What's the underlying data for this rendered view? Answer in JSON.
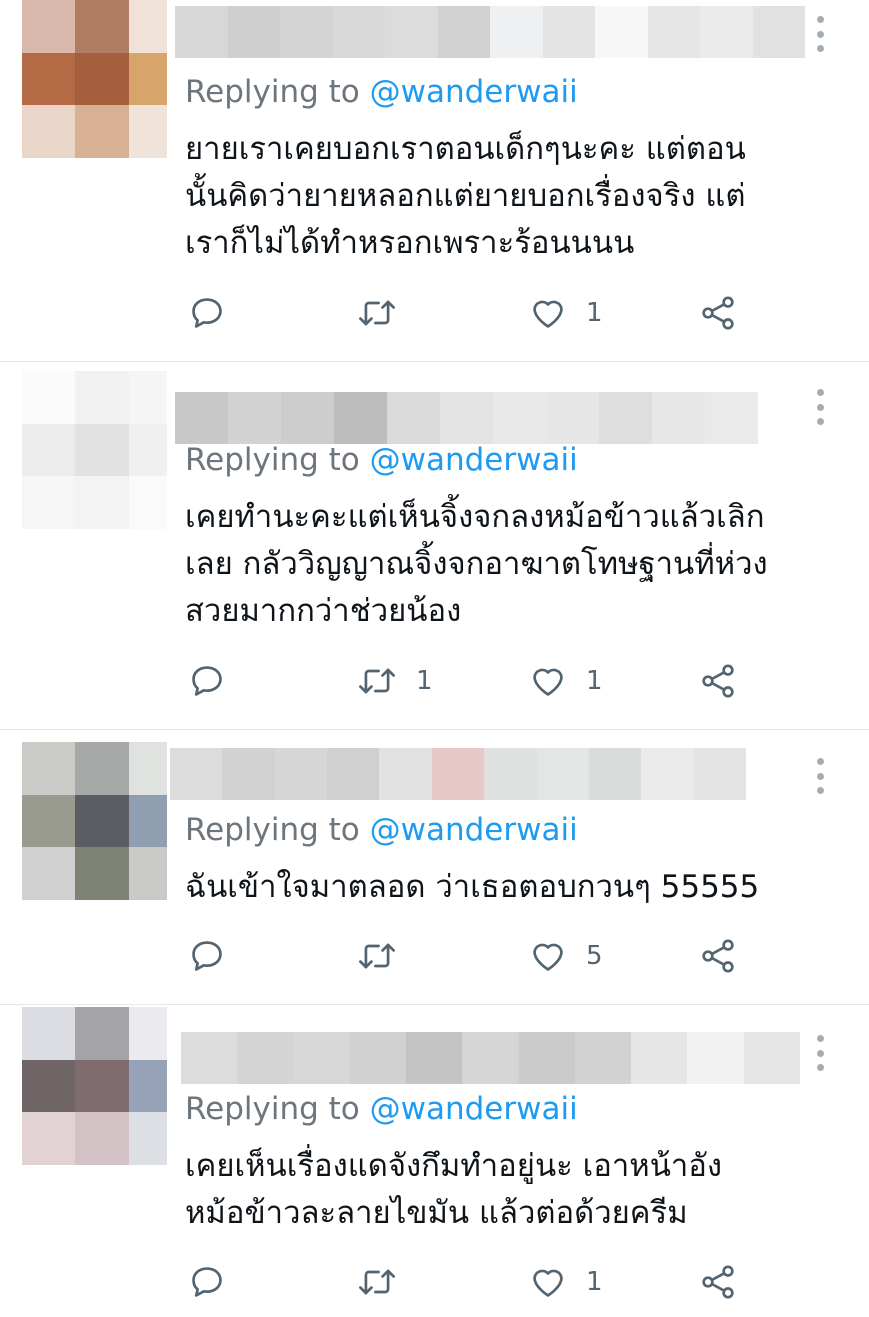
{
  "colors": {
    "text": "#0f1419",
    "secondary": "#6e767d",
    "link": "#1d9bf0",
    "icon": "#536471",
    "divider": "#e6e9ec"
  },
  "icons": {
    "reply": "speech-bubble",
    "retweet": "retweet-arrows",
    "like": "heart-outline",
    "share": "share-nodes",
    "more": "vertical-ellipsis"
  },
  "tweets": [
    {
      "replying_prefix": "Replying to ",
      "replying_handle": "@wanderwaii",
      "text_lines": [
        "ยายเราเคยบอกเราตอนเด็กๆนะคะ แต่ตอน",
        "นั้นคิดว่ายายหลอกแต่ยายบอกเรื่องจริง แต่",
        "เราก็ไม่ได้ทำหรอกเพราะร้อนนนน"
      ],
      "retweets": "",
      "likes": "1"
    },
    {
      "replying_prefix": "Replying to ",
      "replying_handle": "@wanderwaii",
      "text_lines": [
        "เคยทำนะคะแต่เห็นจิ้งจกลงหม้อข้าวแล้วเลิก",
        "เลย กลัววิญญาณจิ้งจกอาฆาตโทษฐานที่ห่วง",
        "สวยมากกว่าช่วยน้อง"
      ],
      "retweets": "1",
      "likes": "1"
    },
    {
      "replying_prefix": "Replying to ",
      "replying_handle": "@wanderwaii",
      "text_lines": [
        "ฉันเข้าใจมาตลอด ว่าเธอตอบกวนๆ 55555"
      ],
      "retweets": "",
      "likes": "5"
    },
    {
      "replying_prefix": "Replying to ",
      "replying_handle": "@wanderwaii",
      "text_lines": [
        "เคยเห็นเรื่องแดจังกึมทำอยู่นะ เอาหน้าอัง",
        "หม้อข้าวละลายไขมัน แล้วต่อด้วยครีม"
      ],
      "retweets": "",
      "likes": "1"
    }
  ]
}
